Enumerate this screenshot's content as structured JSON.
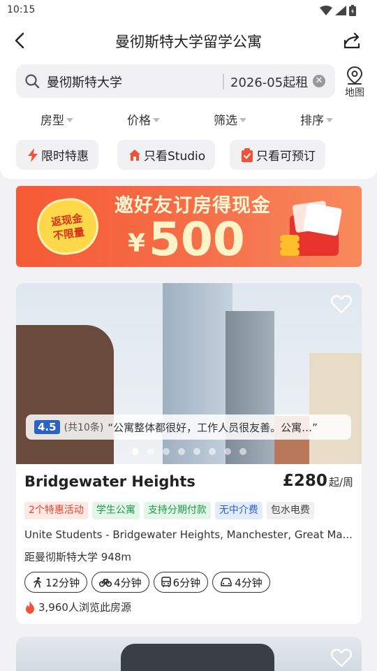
{
  "status_bar": {
    "time": "10:15"
  },
  "nav": {
    "title": "曼彻斯特大学留学公寓"
  },
  "search": {
    "query": "曼彻斯特大学",
    "date": "2026-05起租",
    "map_label": "地图"
  },
  "filters": [
    {
      "label": "房型"
    },
    {
      "label": "价格"
    },
    {
      "label": "筛选"
    },
    {
      "label": "排序"
    }
  ],
  "chips": [
    {
      "label": "限时特惠",
      "icon": "lightning-icon",
      "color": "#f0533a"
    },
    {
      "label": "只看Studio",
      "icon": "house-icon",
      "color": "#f0533a"
    },
    {
      "label": "只看可预订",
      "icon": "clipboard-check-icon",
      "color": "#f0533a"
    }
  ],
  "banner": {
    "badge_line1": "返现金",
    "badge_line2": "不限量",
    "headline": "邀好友订房得现金",
    "currency": "¥",
    "amount": "500"
  },
  "listing": {
    "rating": "4.5",
    "review_count": "(共10条)",
    "review_quote": "“公寓整体都很好，工作人员很友善。公寓…”",
    "carousel_total": 8,
    "carousel_active": 0,
    "name": "Bridgewater Heights",
    "price": "£280",
    "price_unit": "起/周",
    "tags": [
      {
        "label": "2个特惠活动",
        "fg": "#e8452c",
        "bg": "#fde8e4"
      },
      {
        "label": "学生公寓",
        "fg": "#1e9b4a",
        "bg": "#e3f6e8"
      },
      {
        "label": "支持分期付款",
        "fg": "#1e9b4a",
        "bg": "#e3f6e8"
      },
      {
        "label": "无中介费",
        "fg": "#2a63c8",
        "bg": "#e3ecfb"
      },
      {
        "label": "包水电费",
        "fg": "#444444",
        "bg": "#f0f0f0"
      }
    ],
    "address": "Unite Students - Bridgewater Heights, Manchester, Great Ma...",
    "distance": "距曼彻斯特大学 948m",
    "commutes": [
      {
        "icon": "walk-icon",
        "label": "12分钟"
      },
      {
        "icon": "bike-icon",
        "label": "4分钟"
      },
      {
        "icon": "bus-icon",
        "label": "6分钟"
      },
      {
        "icon": "car-icon",
        "label": "4分钟"
      }
    ],
    "views": "3,960人浏览此房源"
  },
  "colors": {
    "accent": "#f0533a",
    "rating_badge": "#2a63c8"
  }
}
